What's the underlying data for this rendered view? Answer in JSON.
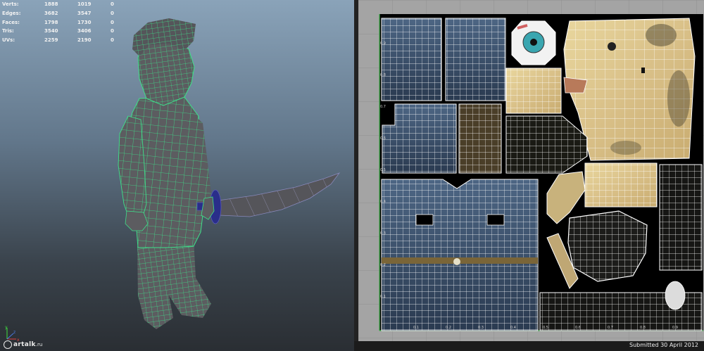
{
  "stats": {
    "rows": [
      {
        "label": "Verts:",
        "values": [
          "1888",
          "1019",
          "0"
        ]
      },
      {
        "label": "Edges:",
        "values": [
          "3682",
          "3547",
          "0"
        ]
      },
      {
        "label": "Faces:",
        "values": [
          "1798",
          "1730",
          "0"
        ]
      },
      {
        "label": "Tris:",
        "values": [
          "3540",
          "3406",
          "0"
        ]
      },
      {
        "label": "UVs:",
        "values": [
          "2259",
          "2190",
          "0"
        ]
      }
    ]
  },
  "viewport": {
    "axis_labels": {
      "y": "y",
      "x": "x",
      "z": "z"
    },
    "wireframe_color": "#3ee08a",
    "mesh_color": "#5c5c60",
    "sword_color": "#55555a",
    "hilt_color": "#2a2e8a"
  },
  "watermark": {
    "text": "artalk",
    "suffix": ".ru"
  },
  "uv_editor": {
    "tick_labels_left": [
      "0.9",
      "0.8",
      "0.7",
      "0.6",
      "0.5",
      "0.4",
      "0.3",
      "0.2",
      "0.1"
    ],
    "tick_labels_bottom": [
      "0.1",
      "0.2",
      "0.3",
      "0.4",
      "0.5",
      "0.6",
      "0.7",
      "0.8",
      "0.9"
    ],
    "colors": {
      "background": "#a4a4a4",
      "texture_bg": "#000000",
      "uv_lines": "#ffffff",
      "face_skin": "#e8d49a",
      "cloth_blue": "#3c5470",
      "grid": "#8a8a8a",
      "axis_green": "#3fb04a"
    }
  },
  "footer": {
    "submitted": "Submitted 30 April 2012"
  }
}
